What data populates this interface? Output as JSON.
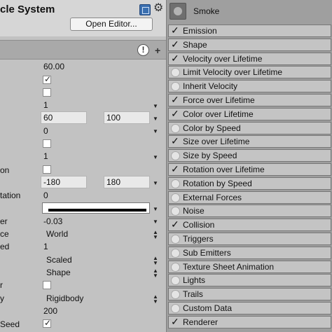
{
  "inspector": {
    "title": "cle System",
    "open_editor": "Open Editor...",
    "rows": {
      "r1_value": "60.00",
      "r2_checked": true,
      "r3_checked": false,
      "r4_value": "1",
      "r5_min": "60",
      "r5_max": "100",
      "r6_value": "0",
      "r7_checked": false,
      "r8_value": "1",
      "r9_label": "on",
      "r9_checked": false,
      "r10_min": "-180",
      "r10_max": "180",
      "r11_label": "tation",
      "r11_value": "0",
      "r13_label": "er",
      "r13_value": "-0.03",
      "r14_label": "ce",
      "r14_value": "World",
      "r15_label": "ed",
      "r15_value": "1",
      "r16_value": "Scaled",
      "r17_value": "Shape",
      "r18_label": "r",
      "r18_checked": false,
      "r19_label": "y",
      "r19_value": "Rigidbody",
      "r20_value": "200",
      "r21_label": "Seed",
      "r21_checked": true
    }
  },
  "modules_panel": {
    "system_name": "Smoke",
    "modules": [
      {
        "label": "Emission",
        "enabled": true
      },
      {
        "label": "Shape",
        "enabled": true
      },
      {
        "label": "Velocity over Lifetime",
        "enabled": true
      },
      {
        "label": "Limit Velocity over Lifetime",
        "enabled": false
      },
      {
        "label": "Inherit Velocity",
        "enabled": false
      },
      {
        "label": "Force over Lifetime",
        "enabled": true
      },
      {
        "label": "Color over Lifetime",
        "enabled": true
      },
      {
        "label": "Color by Speed",
        "enabled": false
      },
      {
        "label": "Size over Lifetime",
        "enabled": true
      },
      {
        "label": "Size by Speed",
        "enabled": false
      },
      {
        "label": "Rotation over Lifetime",
        "enabled": true
      },
      {
        "label": "Rotation by Speed",
        "enabled": false
      },
      {
        "label": "External Forces",
        "enabled": false
      },
      {
        "label": "Noise",
        "enabled": false
      },
      {
        "label": "Collision",
        "enabled": true
      },
      {
        "label": "Triggers",
        "enabled": false
      },
      {
        "label": "Sub Emitters",
        "enabled": false
      },
      {
        "label": "Texture Sheet Animation",
        "enabled": false
      },
      {
        "label": "Lights",
        "enabled": false
      },
      {
        "label": "Trails",
        "enabled": false
      },
      {
        "label": "Custom Data",
        "enabled": false
      },
      {
        "label": "Renderer",
        "enabled": true
      }
    ]
  },
  "icons": {
    "help": "help-book-icon",
    "settings": "gear-icon",
    "info": "info-icon",
    "add": "plus-icon",
    "thumbnail": "particle-thumbnail-icon"
  }
}
